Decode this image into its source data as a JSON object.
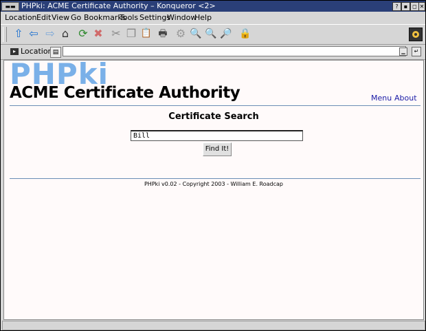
{
  "window": {
    "title": "PHPki: ACME Certificate Authority  – Konqueror <2>",
    "sys_glyph": "▬▬",
    "controls": [
      "?",
      "▪",
      "◻",
      "✕"
    ]
  },
  "menubar": [
    "Location",
    "Edit",
    "View",
    "Go",
    "Bookmarks",
    "Tools",
    "Settings",
    "Window",
    "Help"
  ],
  "toolbar": {
    "icons": [
      "up-arrow",
      "back-arrow",
      "forward-arrow",
      "home",
      "reload",
      "stop",
      "cut",
      "copy",
      "paste",
      "print",
      "print-frame",
      "zoom-in",
      "zoom-out",
      "find",
      "security-lock"
    ],
    "glyphs": [
      "⇧",
      "⇦",
      "⇨",
      "⌂",
      "⟳",
      "✖",
      "✂",
      "❐",
      "📋",
      "🖶",
      "⚙",
      "🔍",
      "🔍",
      "🔎",
      "🔒"
    ]
  },
  "locationbar": {
    "label": "Location",
    "url": ""
  },
  "page": {
    "logo": "PHPki",
    "title": "ACME Certificate Authority",
    "nav": [
      "Menu",
      "About"
    ],
    "heading": "Certificate Search",
    "search_value": "Bill",
    "button": "Find It!",
    "footer": "PHPki v0.02 - Copyright 2003 - William E. Roadcap"
  },
  "colors": {
    "titlebar": "#2a3f78",
    "logo": "#7ab0e8",
    "link": "#1a1aa6",
    "rule": "#6a8cb4"
  }
}
